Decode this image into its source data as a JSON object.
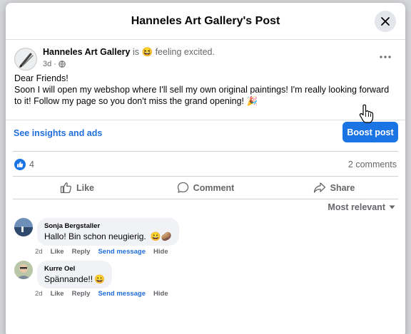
{
  "modal": {
    "title": "Hanneles Art Gallery's Post"
  },
  "post": {
    "author": "Hanneles Art Gallery",
    "is_word": "is",
    "feeling_emoji": "😆",
    "feeling_text": "feeling excited.",
    "time": "3d",
    "body_line1": "Dear Friends!",
    "body_line2": "Soon I will open my webshop where I'll sell my own original paintings! I'm really looking forward to it! Follow my page so you don't miss the grand opening! 🎉"
  },
  "insights": {
    "link_label": "See insights and ads",
    "boost_label": "Boost post"
  },
  "stats": {
    "like_count": "4",
    "comments_label": "2 comments"
  },
  "actions": {
    "like": "Like",
    "comment": "Comment",
    "share": "Share"
  },
  "sort": {
    "label": "Most relevant"
  },
  "comments": [
    {
      "author": "Sonja Bergstaller",
      "text": "Hallo! Bin schon neugierig.",
      "emojis": "😀🥔",
      "time": "2d",
      "like": "Like",
      "reply": "Reply",
      "send": "Send message",
      "hide": "Hide"
    },
    {
      "author": "Kurre Oel",
      "text": "Spännande!!",
      "emojis": "😀",
      "time": "2d",
      "like": "Like",
      "reply": "Reply",
      "send": "Send message",
      "hide": "Hide"
    }
  ],
  "colors": {
    "accent": "#1b74e4",
    "link": "#216fdb",
    "muted": "#65676b"
  }
}
